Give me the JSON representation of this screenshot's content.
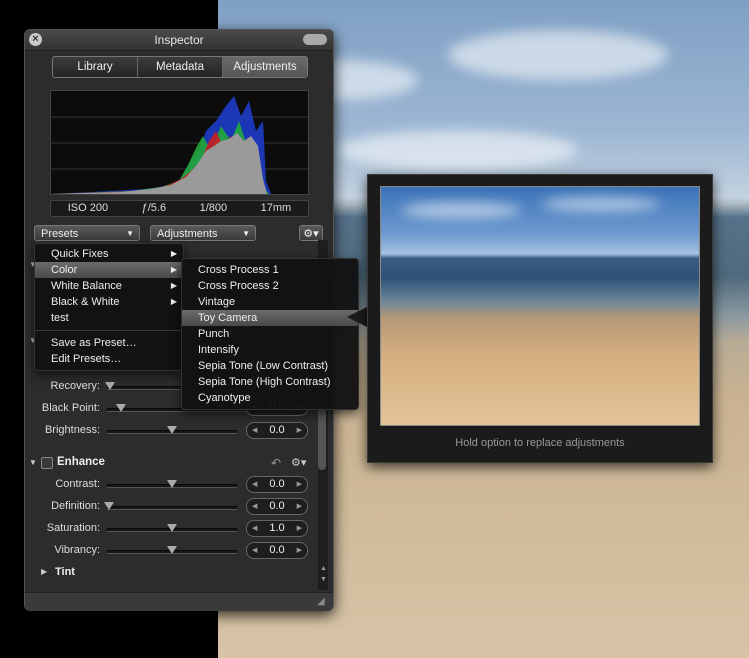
{
  "window": {
    "title": "Inspector"
  },
  "tabs": [
    {
      "label": "Library",
      "active": false
    },
    {
      "label": "Metadata",
      "active": false
    },
    {
      "label": "Adjustments",
      "active": true
    }
  ],
  "exif": {
    "iso": "ISO 200",
    "aperture": "ƒ/5.6",
    "shutter": "1/800",
    "focal": "17mm"
  },
  "toolbar": {
    "presets_label": "Presets",
    "adjustments_label": "Adjustments"
  },
  "presets_menu": {
    "items": [
      {
        "label": "Quick Fixes",
        "submenu": true
      },
      {
        "label": "Color",
        "submenu": true,
        "selected": true
      },
      {
        "label": "White Balance",
        "submenu": true
      },
      {
        "label": "Black & White",
        "submenu": true
      },
      {
        "label": "test",
        "submenu": false
      }
    ],
    "actions": [
      {
        "label": "Save as Preset…"
      },
      {
        "label": "Edit Presets…"
      }
    ]
  },
  "color_submenu": {
    "items": [
      {
        "label": "Cross Process 1"
      },
      {
        "label": "Cross Process 2"
      },
      {
        "label": "Vintage"
      },
      {
        "label": "Toy Camera",
        "selected": true
      },
      {
        "label": "Punch"
      },
      {
        "label": "Intensify"
      },
      {
        "label": "Sepia Tone (Low Contrast)"
      },
      {
        "label": "Sepia Tone (High Contrast)"
      },
      {
        "label": "Cyanotype"
      }
    ]
  },
  "exposure": {
    "rows": [
      {
        "label": "Recovery:",
        "value": ""
      },
      {
        "label": "Black Point:",
        "value": "0.0"
      },
      {
        "label": "Brightness:",
        "value": "0.0"
      }
    ]
  },
  "enhance": {
    "title": "Enhance",
    "rows": [
      {
        "label": "Contrast:",
        "value": "0.0"
      },
      {
        "label": "Definition:",
        "value": "0.0"
      },
      {
        "label": "Saturation:",
        "value": "1.0"
      },
      {
        "label": "Vibrancy:",
        "value": "0.0"
      }
    ],
    "tint_label": "Tint"
  },
  "preview": {
    "caption": "Hold option to replace adjustments"
  },
  "icons": {
    "close": "close-icon",
    "gear": "gear-icon",
    "undo": "undo-icon",
    "disclosure_open": "triangle-down-icon",
    "disclosure_closed": "triangle-right-icon",
    "submenu": "triangle-right-icon",
    "resize": "resize-grip-icon"
  },
  "colors": {
    "panel": "#2c2c2c",
    "menu_selection": "#5a5a5a",
    "histogram_bg": "#0c0c0c"
  }
}
